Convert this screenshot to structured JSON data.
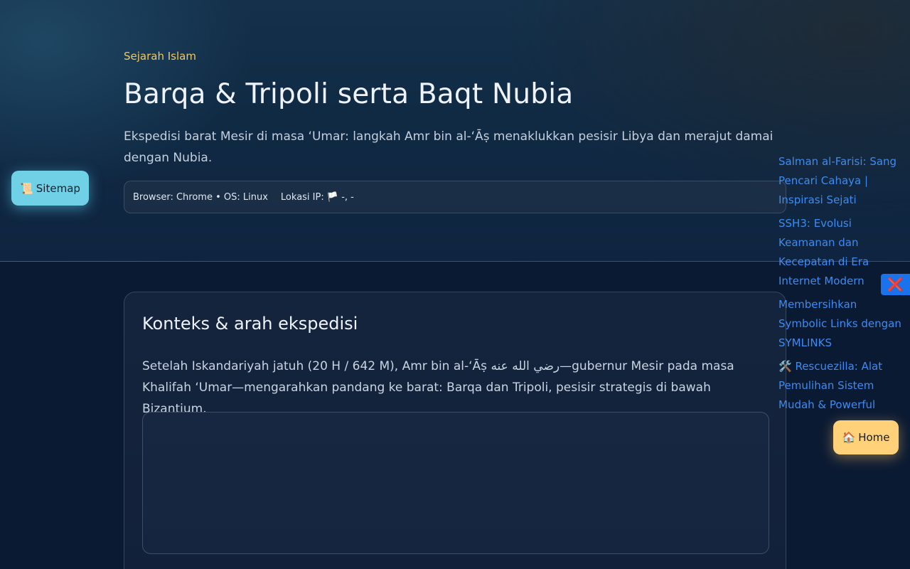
{
  "hero": {
    "kicker": "Sejarah Islam",
    "title": "Barqa & Tripoli serta Baqt Nubia",
    "subtitle": "Ekspedisi barat Mesir di masa ‘Umar: langkah Amr bin al-‘Āṣ menaklukkan pesisir Libya dan merajut damai dengan Nubia.",
    "browser_info": "Browser: Chrome • OS: Linux",
    "ip_label": "Lokasi IP:",
    "ip_flag": "🏳️",
    "ip_value": "-, -"
  },
  "sitemap_button": {
    "icon": "📜",
    "label": "Sitemap"
  },
  "card": {
    "title": "Konteks & arah ekspedisi",
    "text": "Setelah Iskandariyah jatuh (20 H / 642 M), Amr bin al-‘Āṣ رضي الله عنه—gubernur Mesir pada masa Khalifah ‘Umar—mengarahkan pandang ke barat: Barqa dan Tripoli, pesisir strategis di bawah Bizantium."
  },
  "related_links": [
    {
      "label": "Salman al-Farisi: Sang Pencari Cahaya | Inspirasi Sejati"
    },
    {
      "label": "SSH3: Evolusi Keamanan dan Kecepatan di Era Internet Modern"
    },
    {
      "label": "Membersihkan Symbolic Links dengan SYMLINKS"
    },
    {
      "label": "🛠️ Rescuezilla: Alat Pemulihan Sistem Mudah & Powerful"
    }
  ],
  "close_button": {
    "icon": "❌"
  },
  "home_button": {
    "icon": "🏠",
    "label": "Home"
  },
  "colors": {
    "accent_kicker": "#f2c85c",
    "link": "#3d8bf0",
    "sitemap_bg": "#6fd0e6",
    "home_bg": "#ffd27a",
    "close_bg": "#1a73ea"
  }
}
